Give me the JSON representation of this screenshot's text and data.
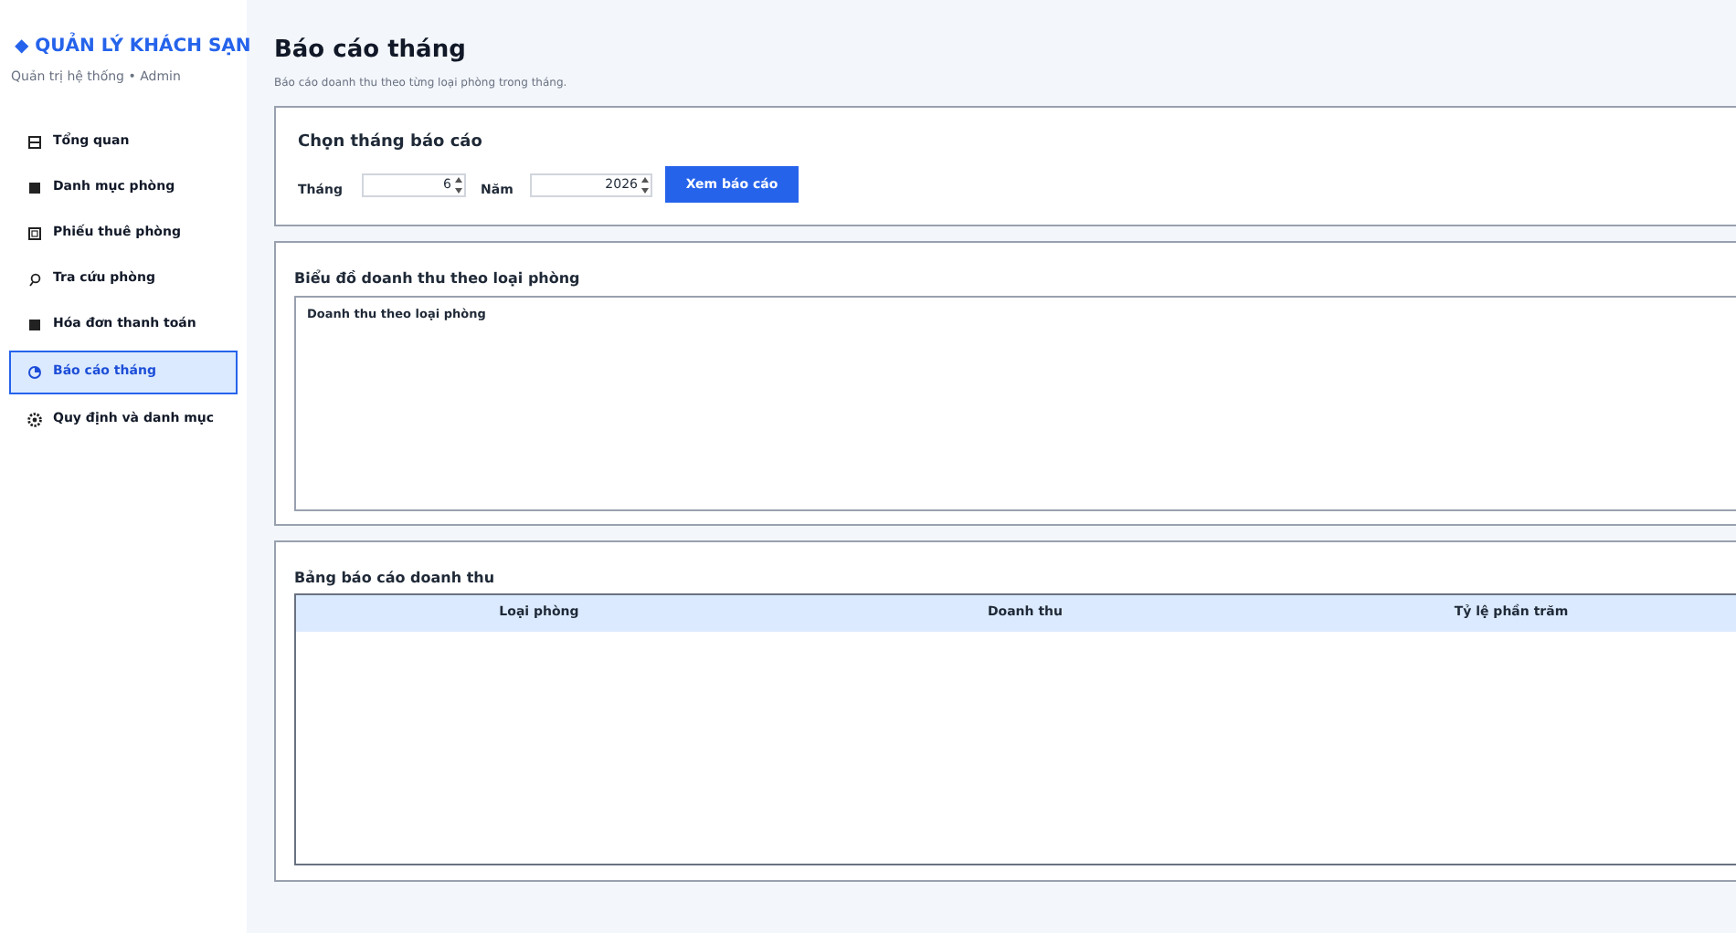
{
  "sidebar": {
    "brand": "◆ QUẢN LÝ KHÁCH SẠN",
    "subtitle": "Quản trị hệ thống • Admin",
    "items": [
      {
        "label": "Tổng quan",
        "selected": false
      },
      {
        "label": "Danh mục phòng",
        "selected": false
      },
      {
        "label": "Phiếu thuê phòng",
        "selected": false
      },
      {
        "label": "Tra cứu phòng",
        "selected": false
      },
      {
        "label": "Hóa đơn thanh toán",
        "selected": false
      },
      {
        "label": "Báo cáo tháng",
        "selected": true
      },
      {
        "label": "Quy định và danh mục",
        "selected": false
      }
    ]
  },
  "page": {
    "title": "Báo cáo tháng",
    "subtitle": "Báo cáo doanh thu theo từng loại phòng trong tháng."
  },
  "filter_card": {
    "title": "Chọn tháng báo cáo",
    "month_label": "Tháng",
    "month_value": "6",
    "year_label": "Năm",
    "year_value": "2026",
    "button": "Xem báo cáo"
  },
  "chart_card": {
    "title": "Biểu đồ doanh thu theo loại phòng",
    "chart_title": "Doanh thu theo loại phòng"
  },
  "table_card": {
    "title": "Bảng báo cáo doanh thu",
    "columns": [
      "Loại phòng",
      "Doanh thu",
      "Tỷ lệ phần trăm"
    ]
  }
}
